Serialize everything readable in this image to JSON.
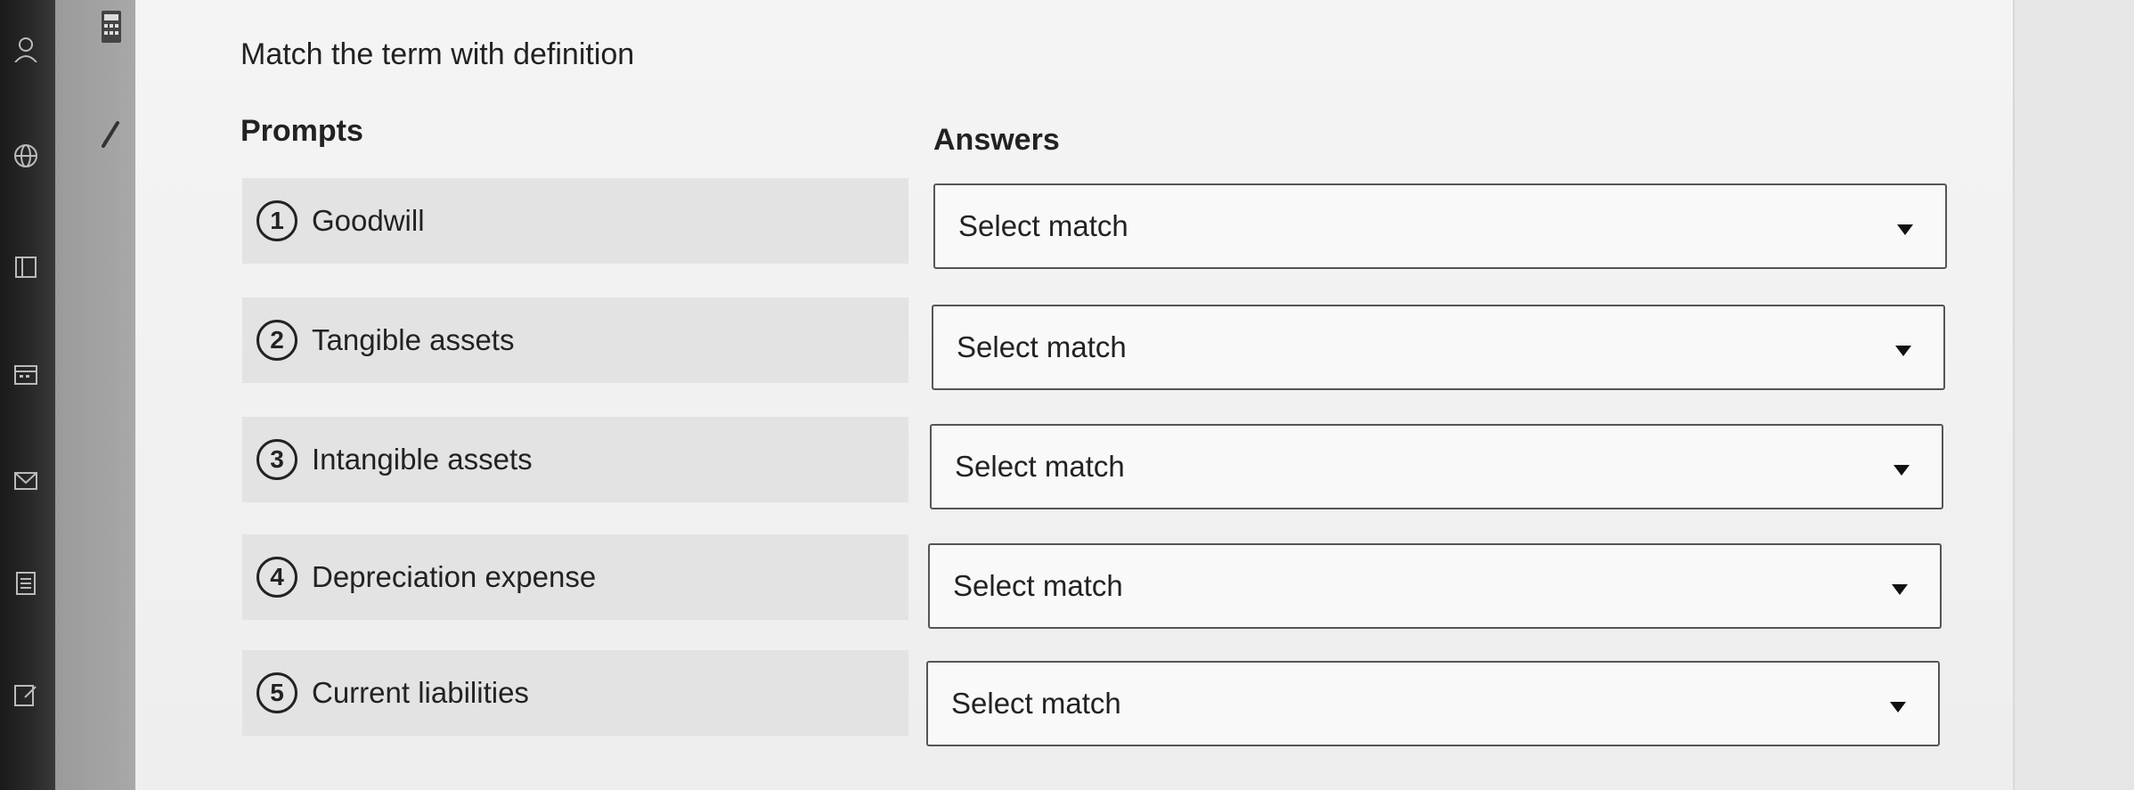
{
  "question": {
    "title": "Match the term with definition"
  },
  "columns": {
    "prompts_label": "Prompts",
    "answers_label": "Answers"
  },
  "prompts": [
    {
      "number": "1",
      "label": "Goodwill"
    },
    {
      "number": "2",
      "label": "Tangible assets"
    },
    {
      "number": "3",
      "label": "Intangible assets"
    },
    {
      "number": "4",
      "label": "Depreciation expense"
    },
    {
      "number": "5",
      "label": "Current liabilities"
    }
  ],
  "answers": [
    {
      "value": "Select match"
    },
    {
      "value": "Select match"
    },
    {
      "value": "Select match"
    },
    {
      "value": "Select match"
    },
    {
      "value": "Select match"
    }
  ],
  "icons": {
    "rail": [
      "person-icon",
      "globe-icon",
      "book-icon",
      "calendar-icon",
      "mail-icon",
      "notes-icon",
      "edit-icon"
    ],
    "toolbar": [
      "calculator-icon",
      "pencil-icon"
    ]
  },
  "colors": {
    "panel_bg": "#f4f4f4",
    "prompt_row_bg": "#e3e3e3",
    "select_border": "#555555",
    "text": "#222222"
  }
}
